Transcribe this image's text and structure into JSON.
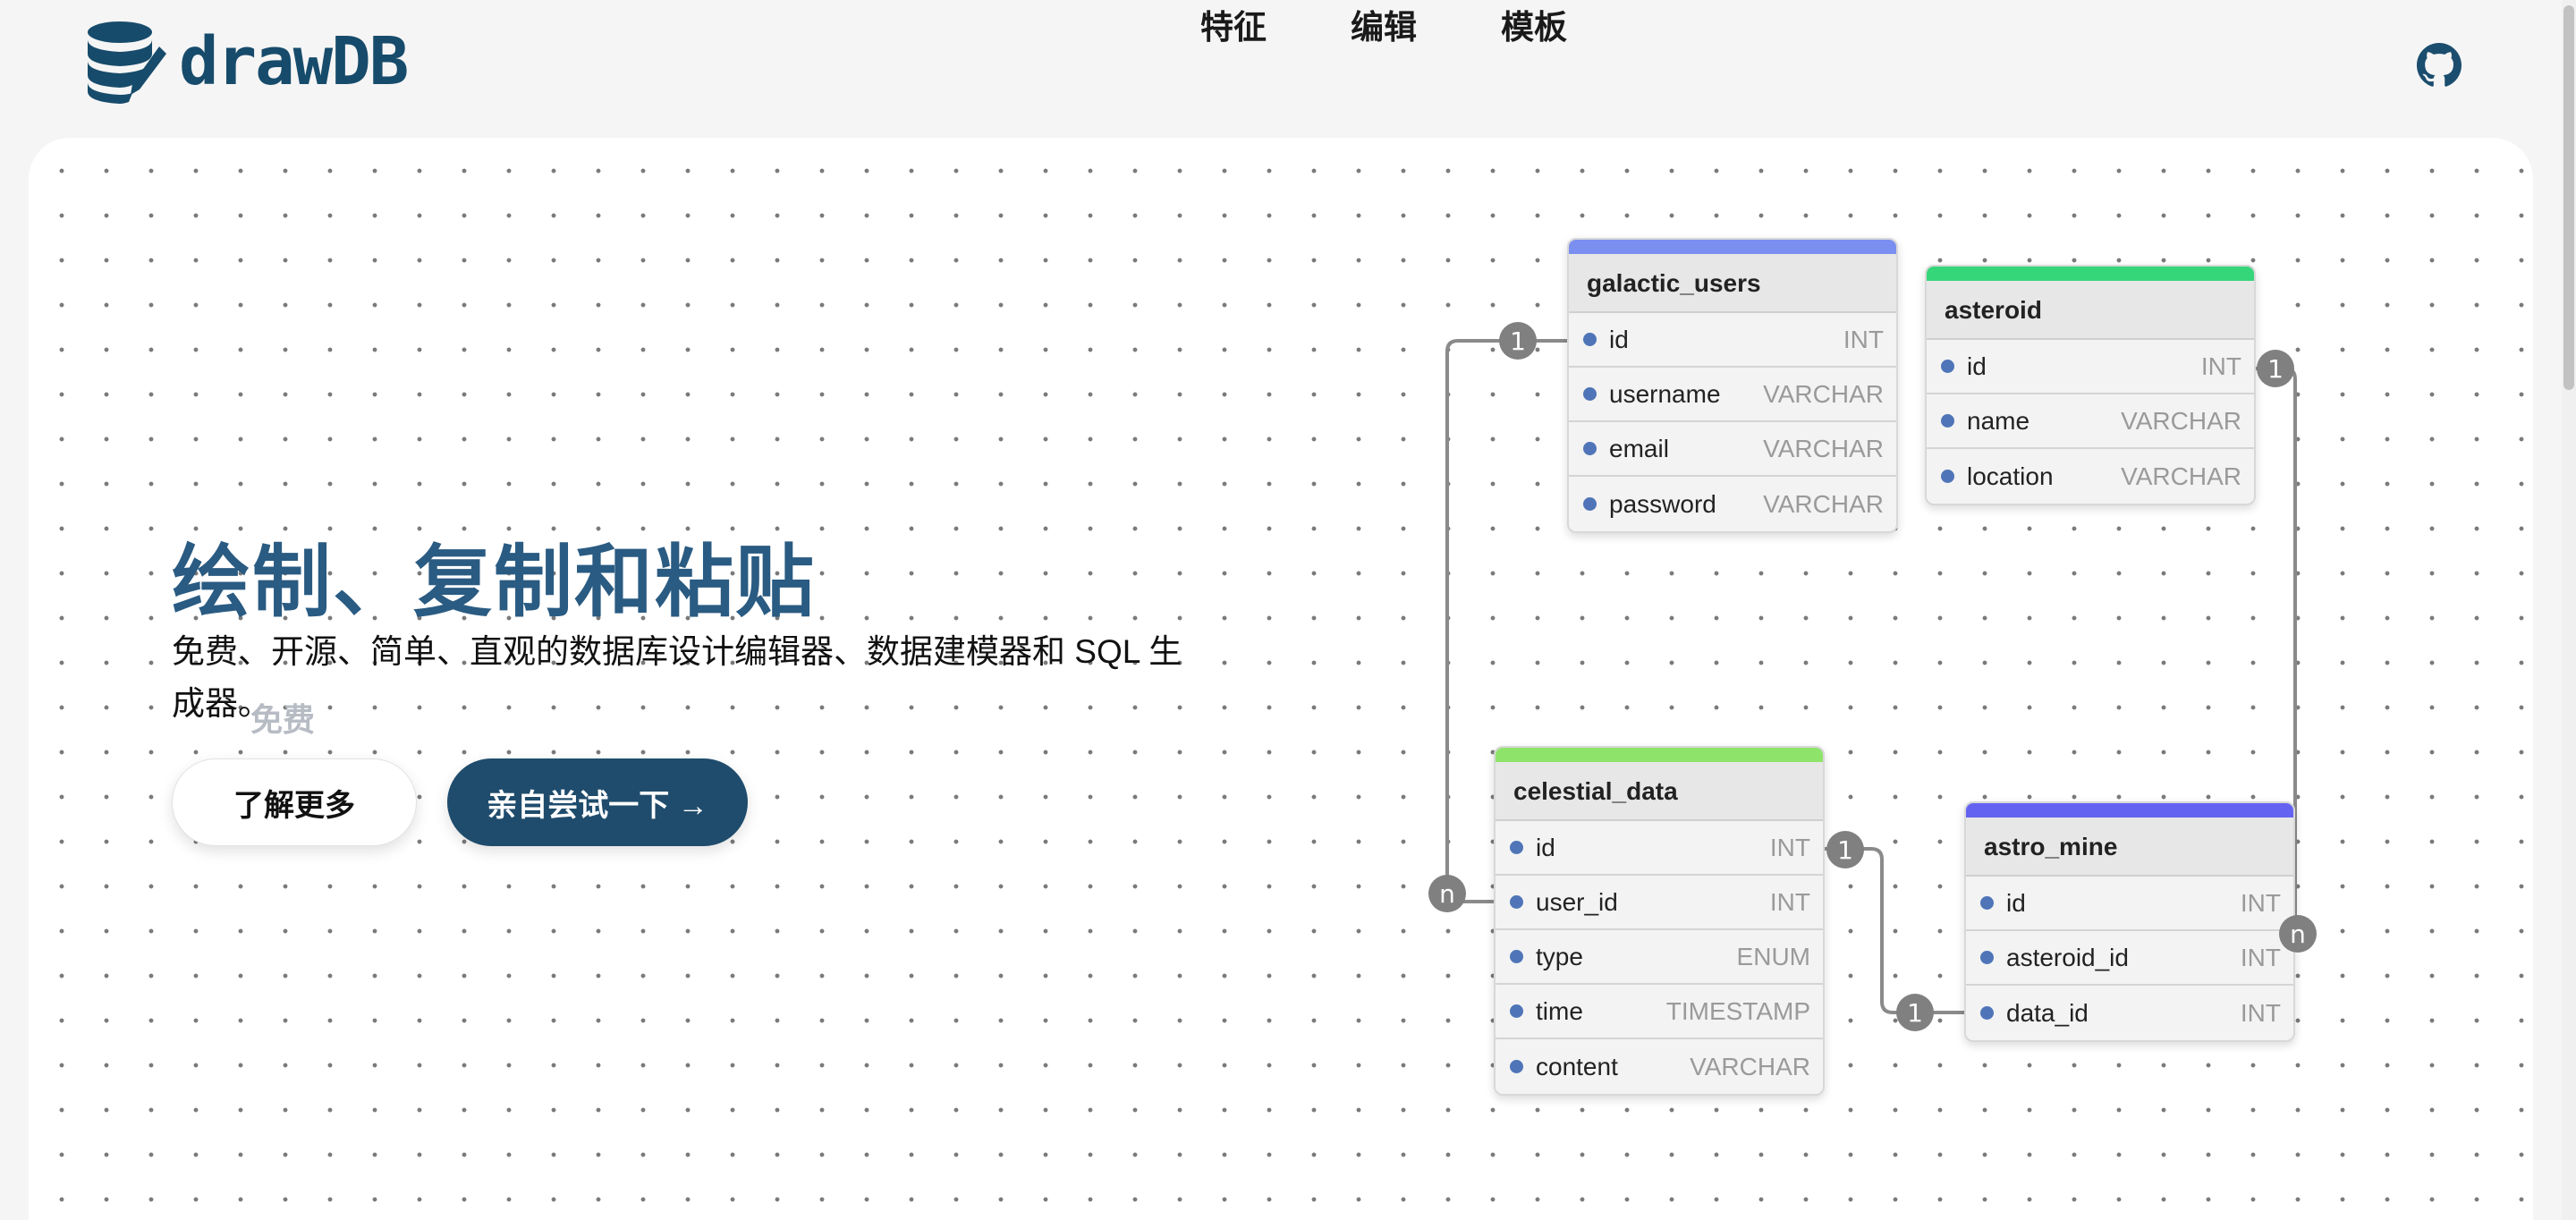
{
  "brand": {
    "name": "drawDB",
    "accent": "#174b6b"
  },
  "nav": [
    {
      "label": "特征"
    },
    {
      "label": "编辑"
    },
    {
      "label": "模板"
    }
  ],
  "github_icon": "github-icon",
  "hero": {
    "title": "绘制、复制和粘贴",
    "description": "免费、开源、简单、直观的数据库设计编辑器、数据建模器和 SQL 生成器。",
    "tag": "免费",
    "learn_more": "了解更多",
    "try_it": "亲自尝试一下 →"
  },
  "tables": [
    {
      "name": "galactic_users",
      "color": "#7b8ff0",
      "fields": [
        {
          "name": "id",
          "type": "INT"
        },
        {
          "name": "username",
          "type": "VARCHAR"
        },
        {
          "name": "email",
          "type": "VARCHAR"
        },
        {
          "name": "password",
          "type": "VARCHAR"
        }
      ]
    },
    {
      "name": "asteroid",
      "color": "#35d57a",
      "fields": [
        {
          "name": "id",
          "type": "INT"
        },
        {
          "name": "name",
          "type": "VARCHAR"
        },
        {
          "name": "location",
          "type": "VARCHAR"
        }
      ]
    },
    {
      "name": "celestial_data",
      "color": "#8ee36a",
      "fields": [
        {
          "name": "id",
          "type": "INT"
        },
        {
          "name": "user_id",
          "type": "INT"
        },
        {
          "name": "type",
          "type": "ENUM"
        },
        {
          "name": "time",
          "type": "TIMESTAMP"
        },
        {
          "name": "content",
          "type": "VARCHAR"
        }
      ]
    },
    {
      "name": "astro_mine",
      "color": "#6463f1",
      "fields": [
        {
          "name": "id",
          "type": "INT"
        },
        {
          "name": "asteroid_id",
          "type": "INT"
        },
        {
          "name": "data_id",
          "type": "INT"
        }
      ]
    }
  ],
  "relationships": [
    {
      "from": "galactic_users.id",
      "to": "celestial_data.user_id",
      "from_card": "1",
      "to_card": "n"
    },
    {
      "from": "celestial_data.id",
      "to": "astro_mine.data_id",
      "from_card": "1",
      "to_card": "1"
    },
    {
      "from": "asteroid.id",
      "to": "astro_mine.asteroid_id",
      "from_card": "1",
      "to_card": "n"
    }
  ]
}
